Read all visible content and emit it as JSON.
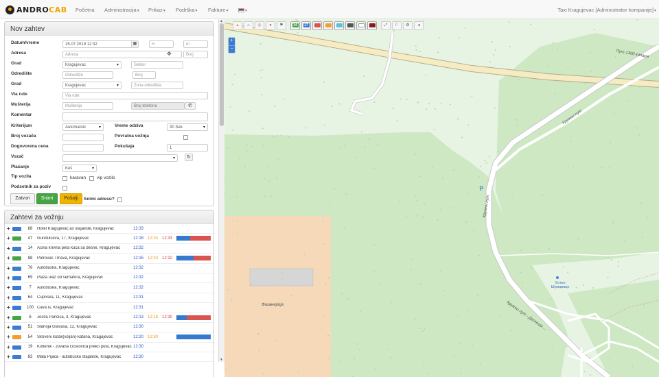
{
  "app": {
    "logo_main": "ANDRO",
    "logo_accent": "CAB",
    "nav": [
      {
        "label": "Početna",
        "dropdown": false
      },
      {
        "label": "Administracija",
        "dropdown": true
      },
      {
        "label": "Prikaz",
        "dropdown": true
      },
      {
        "label": "Podrška",
        "dropdown": true
      },
      {
        "label": "Fakture",
        "dropdown": true
      }
    ],
    "user": "Taxi Kragujevac [Administrator kompanije]"
  },
  "new_request": {
    "title": "Nov zahtev",
    "fields": {
      "datetime_label": "Datum/vreme",
      "datetime_value": "15.07.2019 12:32",
      "hour_placeholder": "H",
      "minute_placeholder": "m",
      "address_label": "Adresa",
      "address_placeholder": "Adresa",
      "number_placeholder": "Broj",
      "city_label": "Grad",
      "city_value": "Kragujevac",
      "sector_placeholder": "Sektor",
      "destination_label": "Odredište",
      "destination_placeholder": "Odredište",
      "dest_number_placeholder": "Broj",
      "city2_label": "Grad",
      "city2_value": "Kragujevac",
      "dest_zone_placeholder": "Zona odredišta",
      "via_label": "Via rute",
      "via_placeholder": "Via rute",
      "customer_label": "Mušterija",
      "customer_placeholder": "Mušterija",
      "phone_placeholder": "Broj telefona",
      "comment_label": "Komentar",
      "criteria_label": "Kriterijum",
      "criteria_value": "Automatski",
      "wait_label": "Vreme odziva",
      "wait_value": "30 Sek.",
      "drivers_label": "Broj vozača",
      "return_label": "Povratna vožnja",
      "price_label": "Dogovorena cena",
      "attempts_label": "Pokušaja",
      "attempts_value": "1",
      "driver_label": "Vozač",
      "payment_label": "Plaćanje",
      "payment_value": "Keš",
      "vehicle_label": "Tip vozila",
      "vehicle_opt1": "karavan",
      "vehicle_opt2": "vip vozilo",
      "reminder_label": "Podsetnik za poziv"
    },
    "buttons": {
      "close": "Zatvori",
      "save": "Snimi",
      "send": "Pošalji",
      "save_address": "Snimi adresu?"
    }
  },
  "rides": {
    "title": "Zahtevi za vožnju",
    "items": [
      {
        "badge": "#3a7bd5",
        "num": "88",
        "addr": "Hotel Kragujevac as stajaliste, Kragujevac",
        "t1": "12:33",
        "t2": "",
        "t3": "",
        "progress": null
      },
      {
        "badge": "#45a545",
        "num": "47",
        "addr": "Gundulceva, 17, Kragujevac",
        "t1": "12:18",
        "t2": "12:24",
        "t3": "12:33",
        "progress": 0.4
      },
      {
        "badge": "#3a7bd5",
        "num": "14",
        "addr": "Acina krivina peta kuca sa desne, Kragujevac",
        "t1": "12:32",
        "t2": "",
        "t3": "",
        "progress": null
      },
      {
        "badge": "#45a545",
        "num": "88",
        "addr": "Petrovac Trnava, Kragujevac",
        "t1": "12:15",
        "t2": "12:23",
        "t3": "12:32",
        "progress": 0.5
      },
      {
        "badge": "#3a7bd5",
        "num": "76",
        "addr": "Autobuska, Kragujevac",
        "t1": "12:32",
        "t2": "",
        "t3": "",
        "progress": null
      },
      {
        "badge": "#3a7bd5",
        "num": "69",
        "addr": "Plaza ulaz od semafora, Kragujevac",
        "t1": "12:32",
        "t2": "",
        "t3": "",
        "progress": null
      },
      {
        "badge": "#3a7bd5",
        "num": "7",
        "addr": "Autobuska, Kragujevac",
        "t1": "12:32",
        "t2": "",
        "t3": "",
        "progress": null
      },
      {
        "badge": "#3a7bd5",
        "num": "64",
        "addr": "Cupriska, 11, Kragujevac",
        "t1": "12:31",
        "t2": "",
        "t3": "",
        "progress": null
      },
      {
        "badge": "#3a7bd5",
        "num": "100",
        "addr": "Cava is, Kragujevac",
        "t1": "12:31",
        "t2": "",
        "t3": "",
        "progress": null
      },
      {
        "badge": "#45a545",
        "num": "6",
        "addr": "Josifa Pancica, 3, Kragujevac",
        "t1": "12:13",
        "t2": "12:18",
        "t3": "12:30",
        "progress": 0.3
      },
      {
        "badge": "#3a7bd5",
        "num": "51",
        "addr": "Stanoja Glavasa, 12, Kragujevac",
        "t1": "12:30",
        "t2": "",
        "t3": "",
        "progress": null
      },
      {
        "badge": "#f0a030",
        "num": "54",
        "addr": "Skriveni kutak(voljan)-kafana, Kragujevac",
        "t1": "12:20",
        "t2": "12:30",
        "t3": "",
        "progress": 1.0
      },
      {
        "badge": "#3a7bd5",
        "num": "19",
        "addr": "Kotlenik - Jovana Gostovica preko puta, Kragujevac",
        "t1": "12:30",
        "t2": "",
        "t3": "",
        "progress": null
      },
      {
        "badge": "#3a7bd5",
        "num": "83",
        "addr": "Mala Pijaca - autobusko stajaliste, Kragujevac",
        "t1": "12:30",
        "t2": "",
        "t3": "",
        "progress": null
      }
    ]
  },
  "map": {
    "toolbar_counts": [
      {
        "value": "14",
        "color": "#45a545"
      },
      {
        "value": "17",
        "color": "#3a7bd5"
      },
      {
        "value": "",
        "color": "#d9534f"
      },
      {
        "value": "",
        "color": "#f0a030"
      },
      {
        "value": "",
        "color": "#5bc0de"
      },
      {
        "value": "",
        "color": "#555555"
      },
      {
        "value": "",
        "color": "#ffffff"
      },
      {
        "value": "",
        "color": "#8b1a1a"
      }
    ],
    "labels": {
      "road1": "Пут 1300 капара",
      "road2": "Кружни пут",
      "road3": "Кружни пут",
      "road4": "Кружни пут - Деоница ...",
      "area": "Фазанерија",
      "hotel": "Хотел Шумарице",
      "parking": "P"
    }
  }
}
